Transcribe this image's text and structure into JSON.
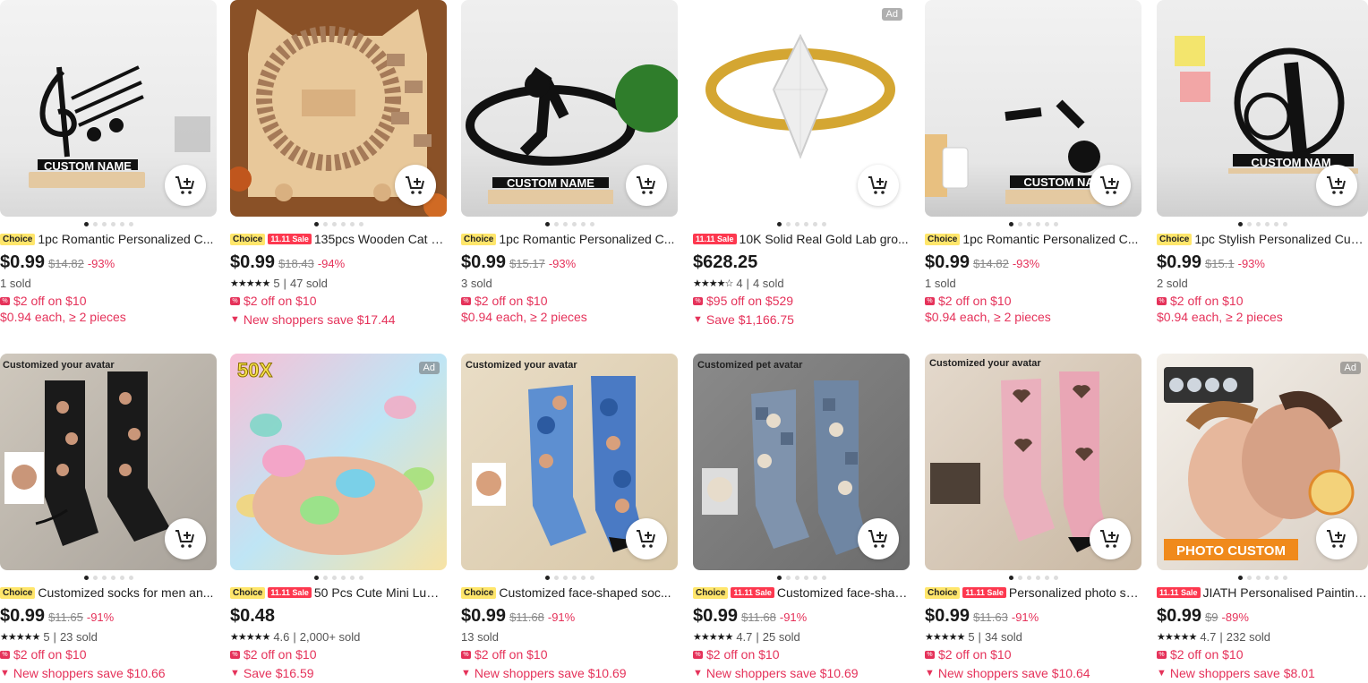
{
  "colors": {
    "accent": "#e5325a",
    "choice_badge": "#ffe66b",
    "sale_badge": "#fd384f"
  },
  "products": [
    {
      "ad": "",
      "choice": "Choice",
      "sale": "",
      "title": "1pc Romantic Personalized C...",
      "price": "$0.99",
      "old": "$14.82",
      "disc": "-93%",
      "stars": "",
      "rating": "",
      "sold": "1 sold",
      "promo": "$2 off on $10",
      "promo2": "$0.94 each, ≥ 2 pieces",
      "img_text": "CUSTOM NAME"
    },
    {
      "ad": "",
      "choice": "Choice",
      "sale": "11.11 Sale",
      "title": "135pcs Wooden Cat P...",
      "price": "$0.99",
      "old": "$18.43",
      "disc": "-94%",
      "stars": "★★★★★",
      "rating": "5",
      "sold": "47 sold",
      "promo": "$2 off on $10",
      "promo2": "New shoppers save $17.44",
      "img_text": ""
    },
    {
      "ad": "",
      "choice": "Choice",
      "sale": "",
      "title": "1pc Romantic Personalized C...",
      "price": "$0.99",
      "old": "$15.17",
      "disc": "-93%",
      "stars": "",
      "rating": "",
      "sold": "3 sold",
      "promo": "$2 off on $10",
      "promo2": "$0.94 each, ≥ 2 pieces",
      "img_text": "CUSTOM NAME"
    },
    {
      "ad": "Ad",
      "choice": "",
      "sale": "11.11 Sale",
      "title": "10K Solid Real Gold Lab gro...",
      "price": "$628.25",
      "old": "",
      "disc": "",
      "stars": "★★★★☆",
      "rating": "4",
      "sold": "4 sold",
      "promo": "$95 off on $529",
      "promo2": "Save $1,166.75",
      "img_text": ""
    },
    {
      "ad": "",
      "choice": "Choice",
      "sale": "",
      "title": "1pc Romantic Personalized C...",
      "price": "$0.99",
      "old": "$14.82",
      "disc": "-93%",
      "stars": "",
      "rating": "",
      "sold": "1 sold",
      "promo": "$2 off on $10",
      "promo2": "$0.94 each, ≥ 2 pieces",
      "img_text": "CUSTOM NAM"
    },
    {
      "ad": "",
      "choice": "Choice",
      "sale": "",
      "title": "1pc Stylish Personalized Cust...",
      "price": "$0.99",
      "old": "$15.1",
      "disc": "-93%",
      "stars": "",
      "rating": "",
      "sold": "2 sold",
      "promo": "$2 off on $10",
      "promo2": "$0.94 each, ≥ 2 pieces",
      "img_text": "CUSTOM NAM"
    },
    {
      "ad": "",
      "choice": "Choice",
      "sale": "",
      "title": "Customized socks for men an...",
      "price": "$0.99",
      "old": "$11.65",
      "disc": "-91%",
      "stars": "★★★★★",
      "rating": "5",
      "sold": "23 sold",
      "promo": "$2 off on $10",
      "promo2": "New shoppers save $10.66",
      "img_text": "Customized your avatar"
    },
    {
      "ad": "Ad",
      "choice": "Choice",
      "sale": "11.11 Sale",
      "title": "50 Pcs Cute Mini Lumi...",
      "price": "$0.48",
      "old": "",
      "disc": "",
      "stars": "★★★★★",
      "rating": "4.6",
      "sold": "2,000+ sold",
      "promo": "$2 off on $10",
      "promo2": "Save $16.59",
      "img_text": "50X"
    },
    {
      "ad": "",
      "choice": "Choice",
      "sale": "",
      "title": "Customized face-shaped soc...",
      "price": "$0.99",
      "old": "$11.68",
      "disc": "-91%",
      "stars": "",
      "rating": "",
      "sold": "13 sold",
      "promo": "$2 off on $10",
      "promo2": "New shoppers save $10.69",
      "img_text": "Customized your avatar"
    },
    {
      "ad": "",
      "choice": "Choice",
      "sale": "11.11 Sale",
      "title": "Customized face-shap...",
      "price": "$0.99",
      "old": "$11.68",
      "disc": "-91%",
      "stars": "★★★★★",
      "rating": "4.7",
      "sold": "25 sold",
      "promo": "$2 off on $10",
      "promo2": "New shoppers save $10.69",
      "img_text": "Customized pet avatar"
    },
    {
      "ad": "",
      "choice": "Choice",
      "sale": "11.11 Sale",
      "title": "Personalized photo so...",
      "price": "$0.99",
      "old": "$11.63",
      "disc": "-91%",
      "stars": "★★★★★",
      "rating": "5",
      "sold": "34 sold",
      "promo": "$2 off on $10",
      "promo2": "New shoppers save $10.64",
      "img_text": "Customized your avatar"
    },
    {
      "ad": "Ad",
      "choice": "",
      "sale": "11.11 Sale",
      "title": "JIATH Personalised Painting ...",
      "price": "$0.99",
      "old": "$9",
      "disc": "-89%",
      "stars": "★★★★★",
      "rating": "4.7",
      "sold": "232 sold",
      "promo": "$2 off on $10",
      "promo2": "New shoppers save $8.01",
      "img_text": "PHOTO CUSTOM"
    }
  ]
}
